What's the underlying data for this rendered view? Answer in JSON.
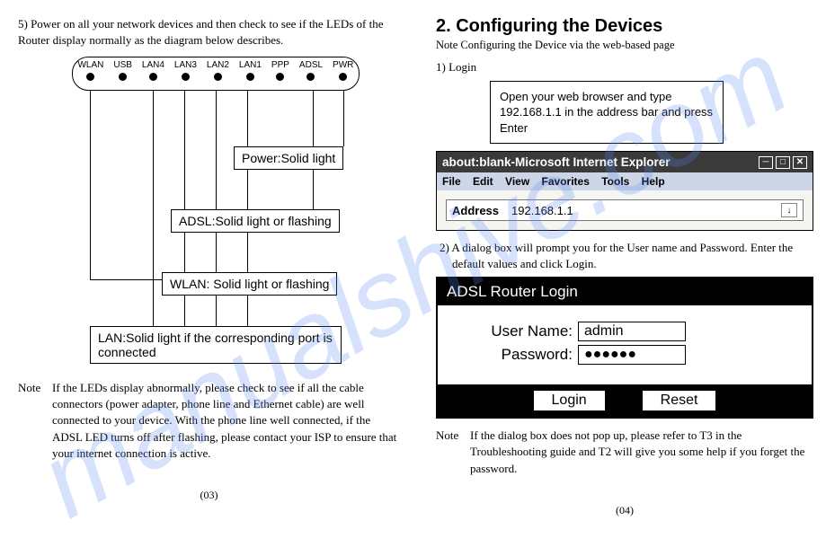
{
  "watermark": "manualshive.com",
  "left": {
    "step5": "5) Power on all your network devices and then check to see if the LEDs of the Router display normally as the diagram below describes.",
    "leds": [
      "WLAN",
      "USB",
      "LAN4",
      "LAN3",
      "LAN2",
      "LAN1",
      "PPP",
      "ADSL",
      "PWR"
    ],
    "callout_power": "Power:Solid light",
    "callout_adsl": "ADSL:Solid light or flashing",
    "callout_wlan": "WLAN: Solid light or flashing",
    "callout_lan": "LAN:Solid light if the corresponding port is connected",
    "note_label": "Note",
    "note_text": "If the LEDs display abnormally, please check to see if all the cable connectors (power adapter, phone line and Ethernet cable) are well connected to your device. With the phone line well connected, if the ADSL LED turns off after flashing, please contact your ISP to ensure that your internet connection is active.",
    "pagenum": "(03)"
  },
  "right": {
    "heading": "2. Configuring the Devices",
    "subnote": "Note  Configuring the Device via the web-based page",
    "step1": "1)  Login",
    "instr": "Open your web browser and type 192.168.1.1 in the address bar and press Enter",
    "browser_title": "about:blank-Microsoft Internet Explorer",
    "menu": {
      "file": "File",
      "edit": "Edit",
      "view": "View",
      "fav": "Favorites",
      "tools": "Tools",
      "help": "Help"
    },
    "addr_label": "Address",
    "addr_value": "192.168.1.1",
    "step2": "2)  A dialog box will prompt you for the User name and Password. Enter the default values and click Login.",
    "login_title": "ADSL Router Login",
    "username_label": "User Name:",
    "username_value": "admin",
    "password_label": "Password:",
    "password_value": "●●●●●●",
    "login_btn": "Login",
    "reset_btn": "Reset",
    "note_label": "Note",
    "note_text": "If the dialog box does not pop up, please refer to T3 in the Troubleshooting guide and T2 will give you some help if you forget the password.",
    "pagenum": "(04)"
  }
}
